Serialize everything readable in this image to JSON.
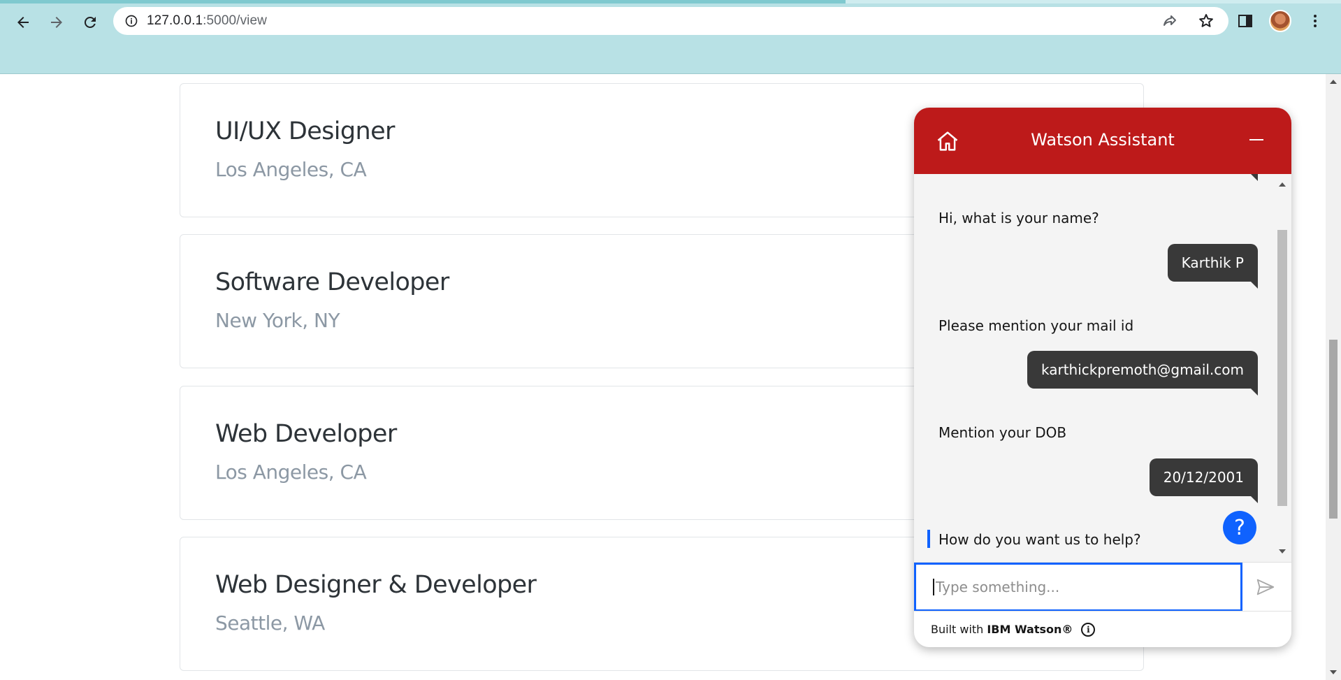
{
  "browser": {
    "url_host": "127.0.0.1",
    "url_path": ":5000/view",
    "icons": [
      "back-arrow-icon",
      "forward-arrow-icon",
      "reload-icon",
      "info-icon",
      "share-icon",
      "star-icon",
      "side-panel-icon",
      "profile-avatar",
      "kebab-menu-icon"
    ]
  },
  "jobs": [
    {
      "title": "UI/UX Designer",
      "location": "Los Angeles, CA"
    },
    {
      "title": "Software Developer",
      "location": "New York, NY"
    },
    {
      "title": "Web Developer",
      "location": "Los Angeles, CA"
    },
    {
      "title": "Web Designer & Developer",
      "location": "Seattle, WA"
    }
  ],
  "watson": {
    "title": "Watson Assistant",
    "messages": [
      {
        "from": "bot",
        "text": "Hi, what is your name?"
      },
      {
        "from": "user",
        "text": "Karthik P"
      },
      {
        "from": "bot",
        "text": "Please mention your mail id"
      },
      {
        "from": "user",
        "text": "karthickpremoth@gmail.com"
      },
      {
        "from": "bot",
        "text": "Mention your DOB"
      },
      {
        "from": "user",
        "text": "20/12/2001"
      },
      {
        "from": "bot",
        "text": "How do you want us to help?"
      }
    ],
    "help_label": "?",
    "input_placeholder": "Type something...",
    "footer_prefix": "Built with",
    "footer_brand": "IBM Watson®",
    "colors": {
      "header": "#bd1a1a",
      "accent": "#0f62fe",
      "user_bubble": "#393939"
    }
  }
}
